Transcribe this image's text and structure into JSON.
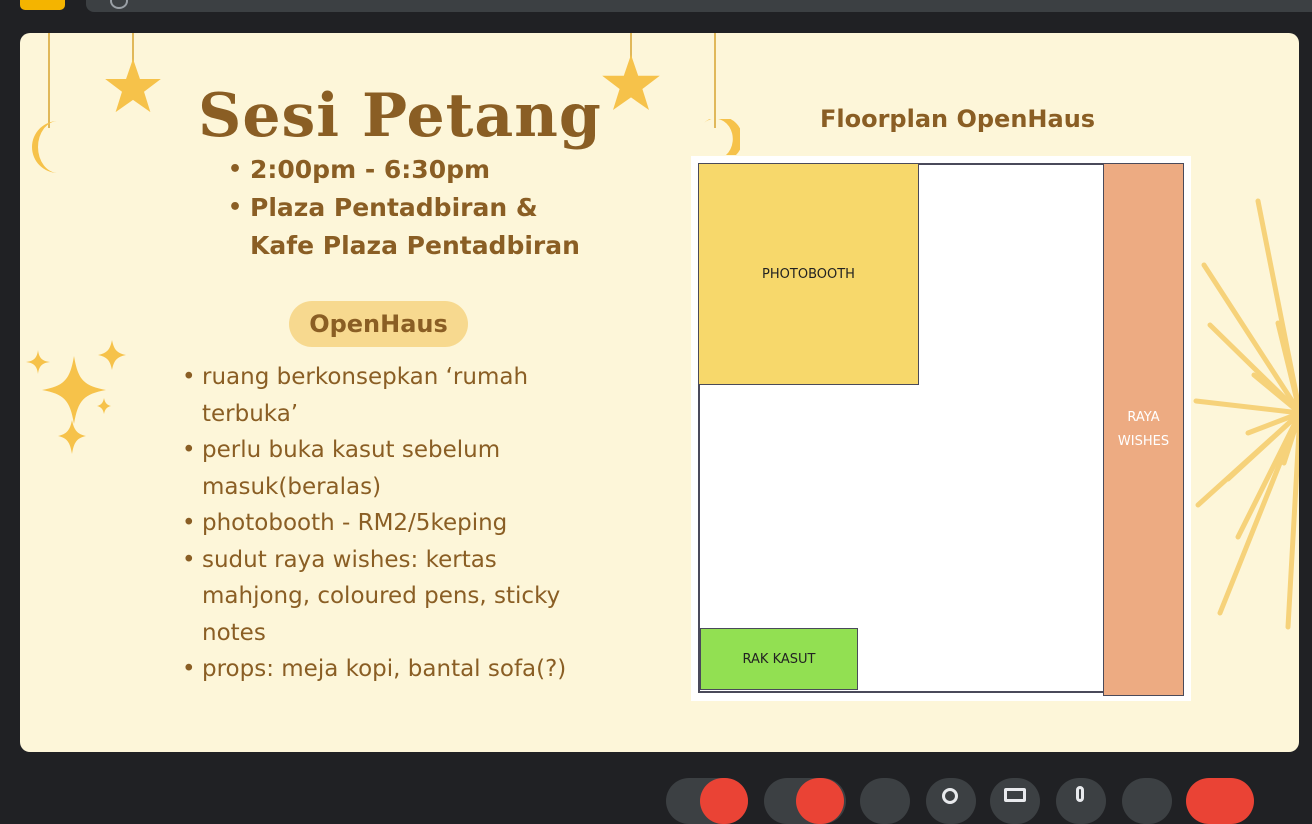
{
  "slide": {
    "title": "Sesi Petang",
    "info": [
      "2:00pm - 6:30pm",
      "Plaza Pentadbiran &",
      "Kafe Plaza Pentadbiran"
    ],
    "section_label": "OpenHaus",
    "details": [
      "ruang berkonsepkan ‘rumah terbuka’",
      "perlu buka kasut sebelum masuk(beralas)",
      "photobooth - RM2/5keping",
      "sudut raya wishes: kertas mahjong, coloured pens, sticky notes",
      "props: meja kopi, bantal sofa(?)"
    ]
  },
  "floorplan": {
    "title": "Floorplan OpenHaus",
    "photobooth": "PHOTOBOOTH",
    "rak_kasut": "RAK KASUT",
    "raya_line1": "RAYA",
    "raya_line2": "WISHES"
  },
  "colors": {
    "slide_bg": "#fdf6d9",
    "text_brown": "#8a5e24",
    "star_gold": "#f6c24a",
    "photobooth": "#f7d86b",
    "rak_kasut": "#92e052",
    "raya_wishes": "#edab82",
    "end_call": "#ea4335"
  },
  "icons": [
    "star-icon",
    "crescent-moon-icon",
    "sparkle-icon",
    "sunburst-decoration",
    "microphone-icon",
    "camera-icon",
    "hand-icon",
    "present-icon",
    "more-icon",
    "end-call-icon"
  ]
}
